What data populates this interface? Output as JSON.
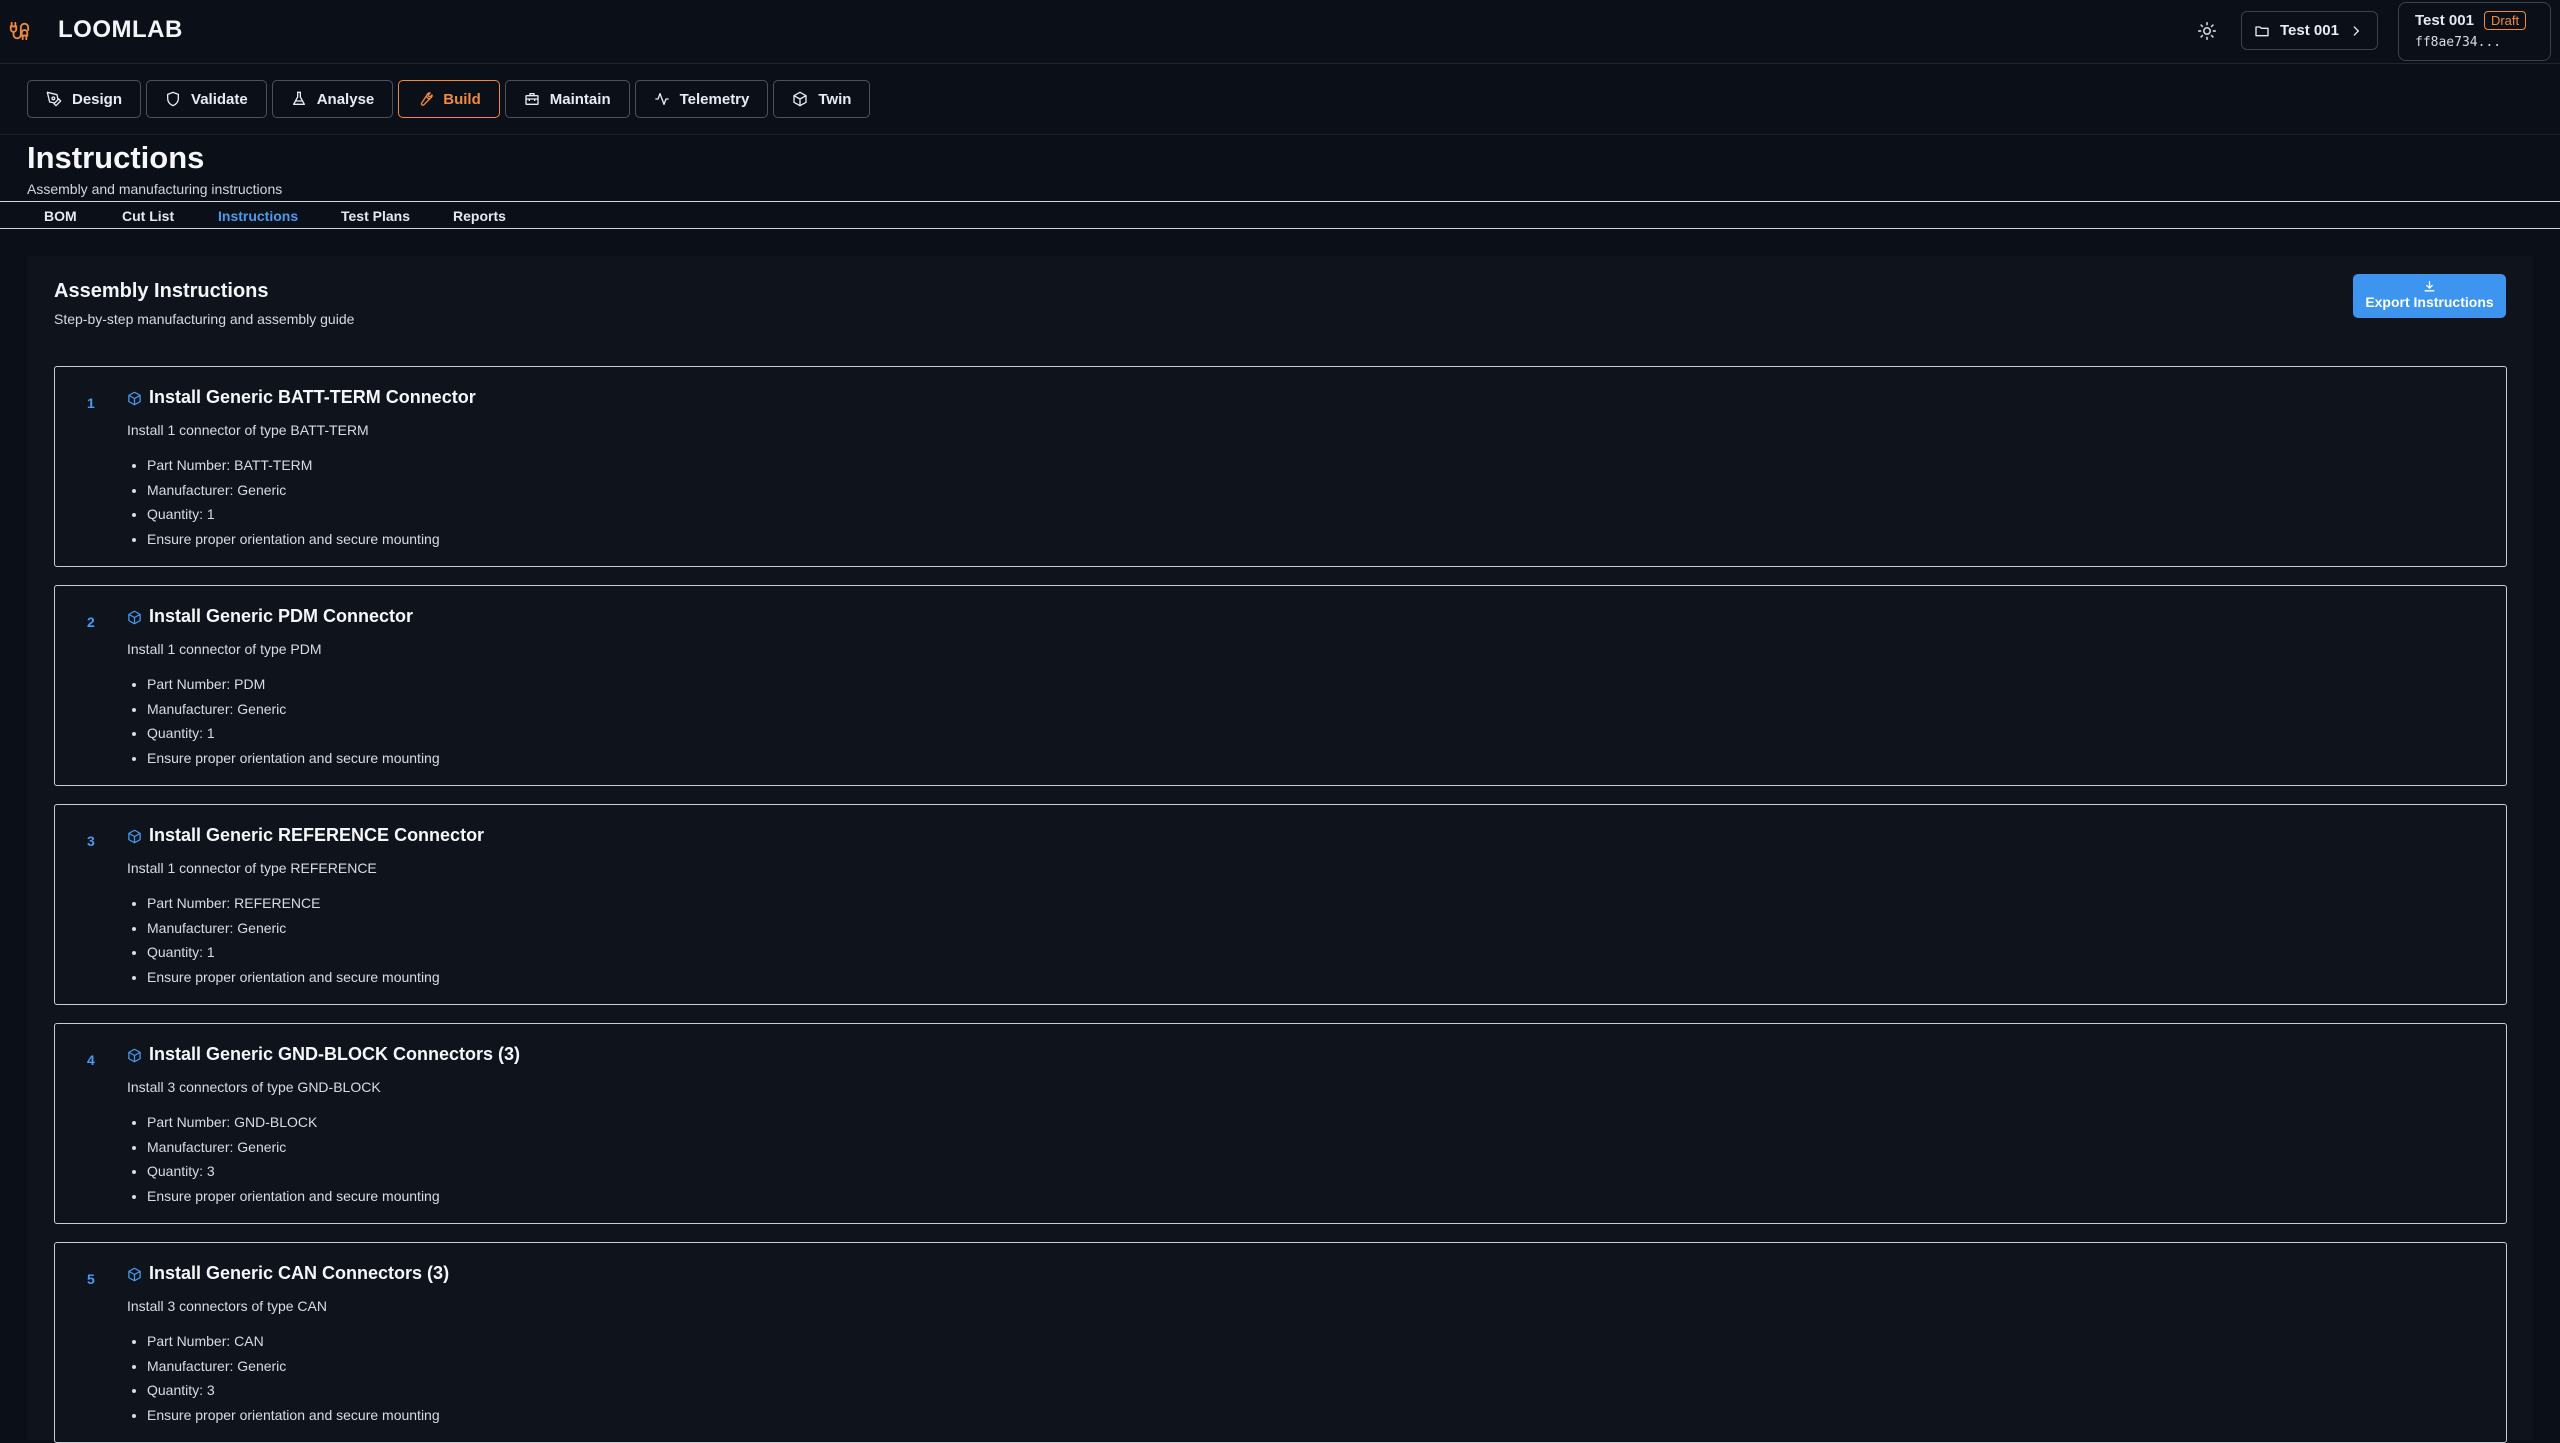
{
  "app": {
    "title": "LOOMLAB"
  },
  "project": {
    "button_label": "Test 001",
    "name": "Test 001",
    "status": "Draft",
    "hash": "ff8ae734..."
  },
  "modes": [
    {
      "label": "Design",
      "icon": "pen-tool-icon"
    },
    {
      "label": "Validate",
      "icon": "shield-icon"
    },
    {
      "label": "Analyse",
      "icon": "flask-icon"
    },
    {
      "label": "Build",
      "icon": "wrench-icon",
      "active": true
    },
    {
      "label": "Maintain",
      "icon": "toolbox-icon"
    },
    {
      "label": "Telemetry",
      "icon": "activity-icon"
    },
    {
      "label": "Twin",
      "icon": "cube-icon"
    }
  ],
  "page": {
    "title": "Instructions",
    "subtitle": "Assembly and manufacturing instructions"
  },
  "subtabs": [
    {
      "label": "BOM"
    },
    {
      "label": "Cut List"
    },
    {
      "label": "Instructions",
      "active": true
    },
    {
      "label": "Test Plans"
    },
    {
      "label": "Reports"
    }
  ],
  "panel": {
    "title": "Assembly Instructions",
    "subtitle": "Step-by-step manufacturing and assembly guide",
    "export_label": "Export Instructions"
  },
  "steps": [
    {
      "num": "1",
      "title": "Install Generic BATT-TERM Connector",
      "desc": "Install 1 connector of type BATT-TERM",
      "items": [
        "Part Number: BATT-TERM",
        "Manufacturer: Generic",
        "Quantity: 1",
        "Ensure proper orientation and secure mounting"
      ]
    },
    {
      "num": "2",
      "title": "Install Generic PDM Connector",
      "desc": "Install 1 connector of type PDM",
      "items": [
        "Part Number: PDM",
        "Manufacturer: Generic",
        "Quantity: 1",
        "Ensure proper orientation and secure mounting"
      ]
    },
    {
      "num": "3",
      "title": "Install Generic REFERENCE Connector",
      "desc": "Install 1 connector of type REFERENCE",
      "items": [
        "Part Number: REFERENCE",
        "Manufacturer: Generic",
        "Quantity: 1",
        "Ensure proper orientation and secure mounting"
      ]
    },
    {
      "num": "4",
      "title": "Install Generic GND-BLOCK Connectors (3)",
      "desc": "Install 3 connectors of type GND-BLOCK",
      "items": [
        "Part Number: GND-BLOCK",
        "Manufacturer: Generic",
        "Quantity: 3",
        "Ensure proper orientation and secure mounting"
      ]
    },
    {
      "num": "5",
      "title": "Install Generic CAN Connectors (3)",
      "desc": "Install 3 connectors of type CAN",
      "items": [
        "Part Number: CAN",
        "Manufacturer: Generic",
        "Quantity: 3",
        "Ensure proper orientation and secure mounting"
      ]
    }
  ],
  "colors": {
    "accent": "#f08a3c",
    "link": "#4a9bf0",
    "primary_button": "#3d95ef",
    "background": "#0b0f17"
  }
}
